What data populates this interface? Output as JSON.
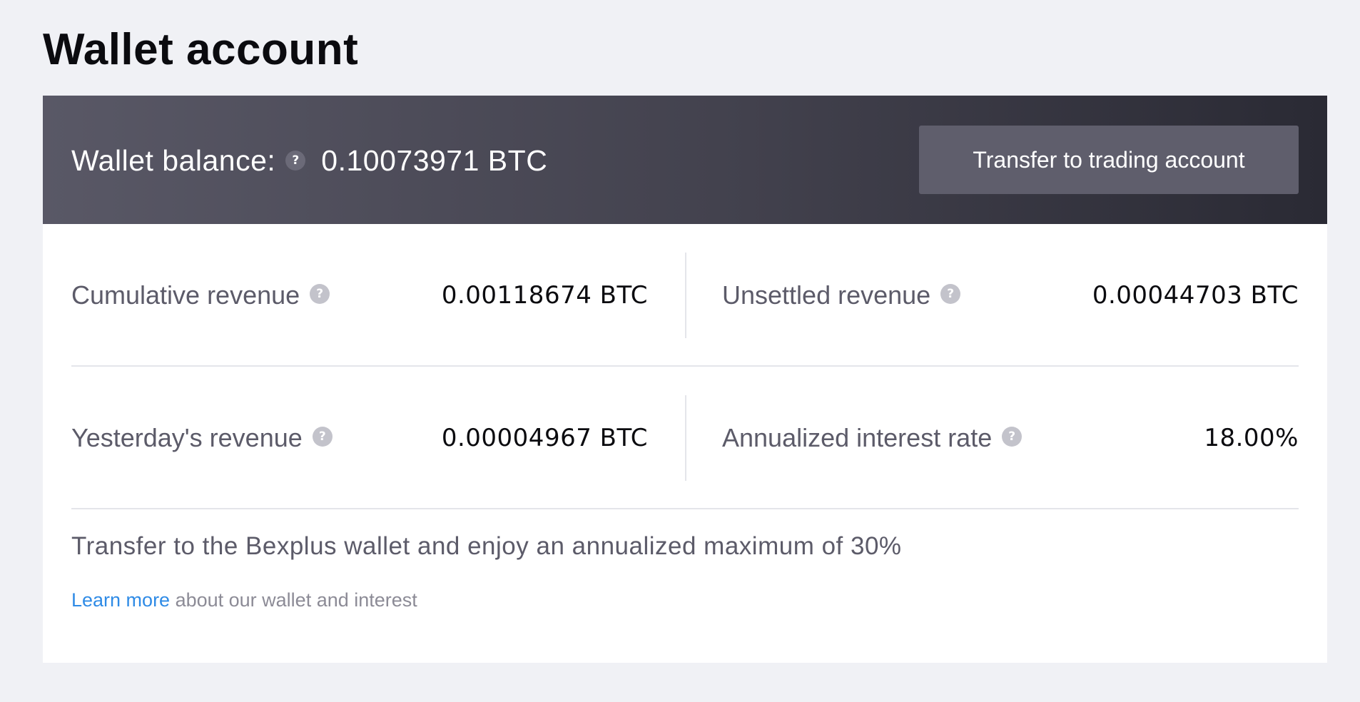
{
  "page": {
    "title": "Wallet account"
  },
  "wallet": {
    "balance_label": "Wallet balance:",
    "balance_value": "0.10073971 BTC",
    "help_icon": "question-circle-icon",
    "transfer_button_label": "Transfer to trading account"
  },
  "stats": {
    "cumulative_revenue": {
      "label": "Cumulative revenue",
      "value": "0.00118674 BTC"
    },
    "unsettled_revenue": {
      "label": "Unsettled revenue",
      "value": "0.00044703 BTC"
    },
    "yesterdays_revenue": {
      "label": "Yesterday's revenue",
      "value": "0.00004967 BTC"
    },
    "annualized_interest_rate": {
      "label": "Annualized interest rate",
      "value": "18.00%"
    }
  },
  "promo": {
    "text": "Transfer to the Bexplus wallet and enjoy an annualized maximum of 30%",
    "learn_more_link": "Learn more",
    "learn_more_suffix": " about our wallet and interest"
  },
  "icons": {
    "help_glyph": "?"
  },
  "colors": {
    "page_background": "#f0f1f5",
    "header_gradient_start": "#595866",
    "header_gradient_end": "#2a2a34",
    "button_background": "#5f5e6c",
    "link": "#2f8be6",
    "label_text": "#5c5b69",
    "value_text": "#0b0b0f"
  }
}
